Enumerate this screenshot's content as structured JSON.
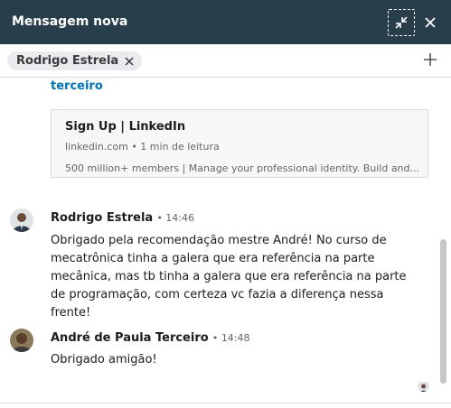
{
  "header": {
    "title": "Mensagem nova",
    "minimize_icon": "minimize-arrows-icon",
    "close_icon": "close-icon",
    "background_color": "#283e4a"
  },
  "recipients": [
    {
      "name": "Rodrigo Estrela",
      "remove_icon": "close-icon"
    }
  ],
  "add_recipient_icon": "plus-icon",
  "thread": {
    "link_text": "terceiro",
    "link_preview": {
      "title": "Sign Up | LinkedIn",
      "meta": "linkedin.com • 1 min de leitura",
      "description": "500 million+ members | Manage your professional identity. Build and..."
    },
    "messages": [
      {
        "sender": "Rodrigo Estrela",
        "time": "• 14:46",
        "text": "Obrigado pela recomendação mestre André! No curso de mecatrônica tinha a galera que era referência na parte mecânica, mas tb tinha a galera que era referência na parte de programação, com certeza vc fazia a diferença nessa frente!"
      },
      {
        "sender": "André de Paula Terceiro",
        "time": "• 14:48",
        "text": "Obrigado amigão!"
      }
    ]
  },
  "colors": {
    "link": "#0073b1",
    "chip_bg": "#e9ebee"
  }
}
